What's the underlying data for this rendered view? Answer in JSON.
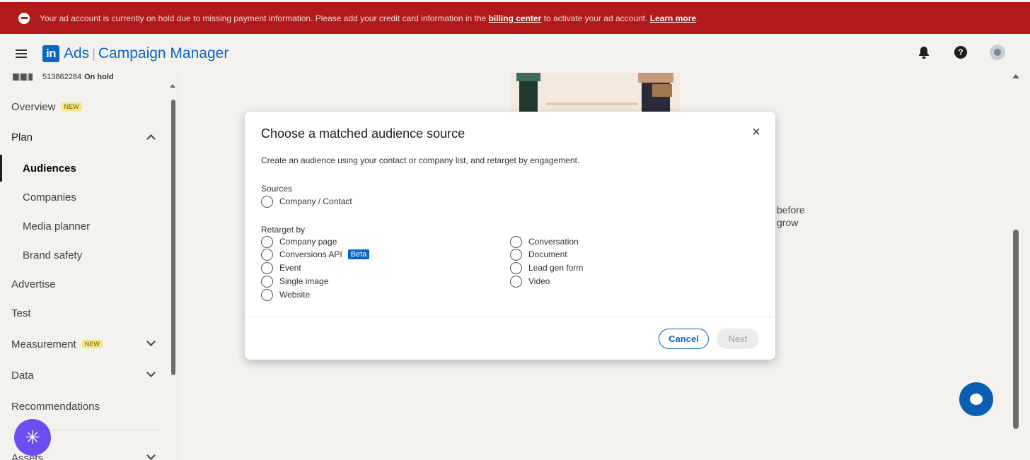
{
  "banner": {
    "text_before": "Your ad account is currently on hold due to missing payment information. Please add your credit card information in the ",
    "billing_link": "billing center",
    "text_after": " to activate your ad account. ",
    "learn_more": "Learn more",
    "color": "#b11a1a"
  },
  "header": {
    "logo_text": "in",
    "product": "Ads",
    "separator": "|",
    "app_name": "Campaign Manager",
    "icons": [
      "menu-icon",
      "bell-icon",
      "help-icon",
      "avatar"
    ]
  },
  "sidebar": {
    "account_id": "513862284",
    "account_status": "On hold",
    "items": [
      {
        "label": "Overview",
        "badge": "NEW"
      },
      {
        "label": "Plan"
      },
      {
        "label": "Audiences"
      },
      {
        "label": "Companies"
      },
      {
        "label": "Media planner"
      },
      {
        "label": "Brand safety"
      },
      {
        "label": "Advertise"
      },
      {
        "label": "Test"
      },
      {
        "label": "Measurement",
        "badge": "NEW"
      },
      {
        "label": "Data"
      },
      {
        "label": "Recommendations"
      },
      {
        "label": "Assets"
      }
    ]
  },
  "main": {
    "text_line1": "before",
    "text_line2": "grow"
  },
  "modal": {
    "title": "Choose a matched audience source",
    "close_label": "×",
    "description": "Create an audience using your contact or company list, and retarget by engagement.",
    "sources_label": "Sources",
    "sources": [
      "Company / Contact"
    ],
    "retarget_label": "Retarget by",
    "retarget_left": [
      "Company page",
      "Conversions API",
      "Event",
      "Single image",
      "Website"
    ],
    "retarget_right": [
      "Conversation",
      "Document",
      "Lead gen form",
      "Video"
    ],
    "beta_badge": "Beta",
    "cancel": "Cancel",
    "next": "Next"
  },
  "colors": {
    "accent": "#0a66c2",
    "banner": "#b11a1a",
    "ai_button": "#6d4df2"
  }
}
